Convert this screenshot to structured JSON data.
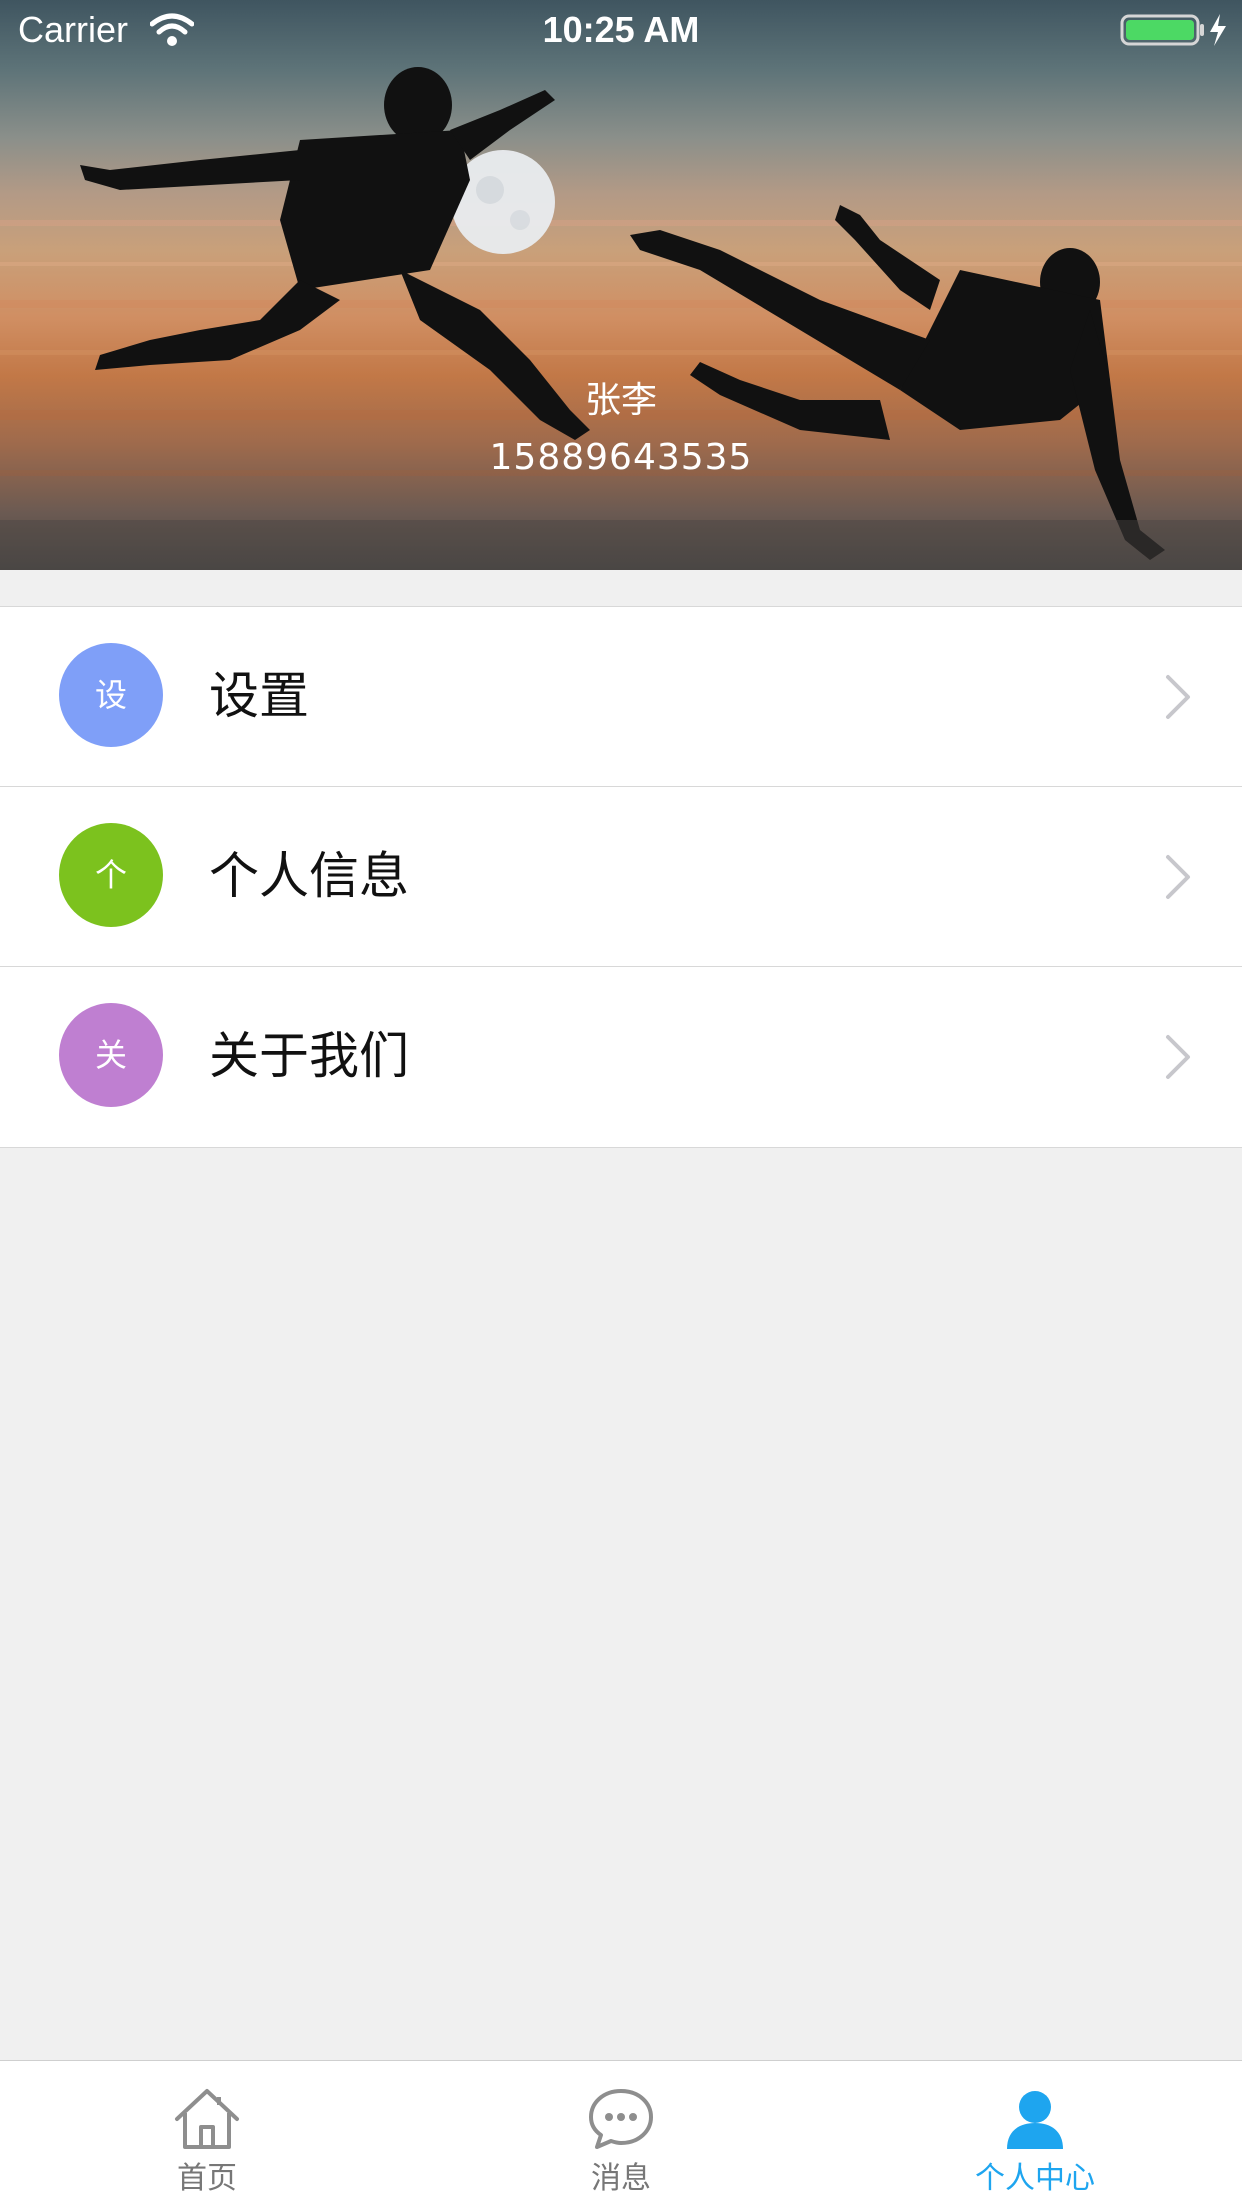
{
  "status_bar": {
    "carrier": "Carrier",
    "time": "10:25 AM",
    "battery_color": "#4cd964"
  },
  "profile": {
    "name": "张李",
    "phone": "15889643535"
  },
  "menu": {
    "items": [
      {
        "badge": "设",
        "label": "设置",
        "color": "#7f9ff8"
      },
      {
        "badge": "个",
        "label": "个人信息",
        "color": "#7cc21e"
      },
      {
        "badge": "关",
        "label": "关于我们",
        "color": "#bf7fd1"
      }
    ]
  },
  "tabbar": {
    "active_color": "#1ea5ef",
    "inactive_color": "#777777",
    "tabs": [
      {
        "label": "首页",
        "icon": "home-icon",
        "active": false
      },
      {
        "label": "消息",
        "icon": "chat-bubble-icon",
        "active": false
      },
      {
        "label": "个人中心",
        "icon": "person-icon",
        "active": true
      }
    ]
  }
}
